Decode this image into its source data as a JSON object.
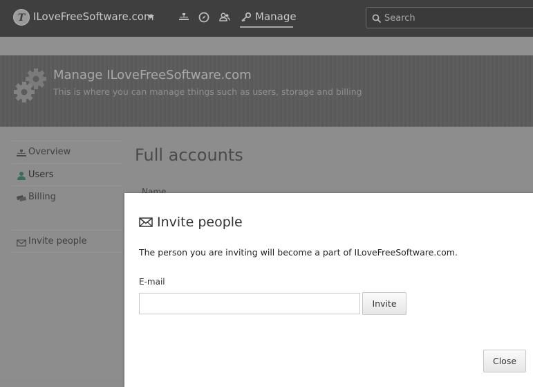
{
  "topbar": {
    "site_name": "ILoveFreeSoftware.com",
    "nav_icons": [
      "sitemap-icon",
      "compass-icon",
      "users-icon"
    ],
    "manage_label": "Manage",
    "search_placeholder": "Search"
  },
  "banner": {
    "title": "Manage ILoveFreeSoftware.com",
    "subtitle": "This is where you can manage things such as users, storage and billing"
  },
  "sidebar": {
    "items": [
      {
        "label": "Overview",
        "icon": "sitemap-icon"
      },
      {
        "label": "Users",
        "icon": "user-icon",
        "active": true
      },
      {
        "label": "Billing",
        "icon": "money-icon"
      },
      {
        "label": "Invite people",
        "icon": "envelope-icon"
      }
    ]
  },
  "main": {
    "heading": "Full accounts",
    "column_name": "Name"
  },
  "modal": {
    "title": "Invite people",
    "description": "The person you are inviting will become a part of ILoveFreeSoftware.com.",
    "email_label": "E-mail",
    "email_value": "",
    "invite_label": "Invite",
    "close_label": "Close"
  },
  "colors": {
    "topbar": "#3f3f3f",
    "overlay": "#8d8d8d",
    "modal_bg": "#ffffff",
    "text": "#333333"
  }
}
